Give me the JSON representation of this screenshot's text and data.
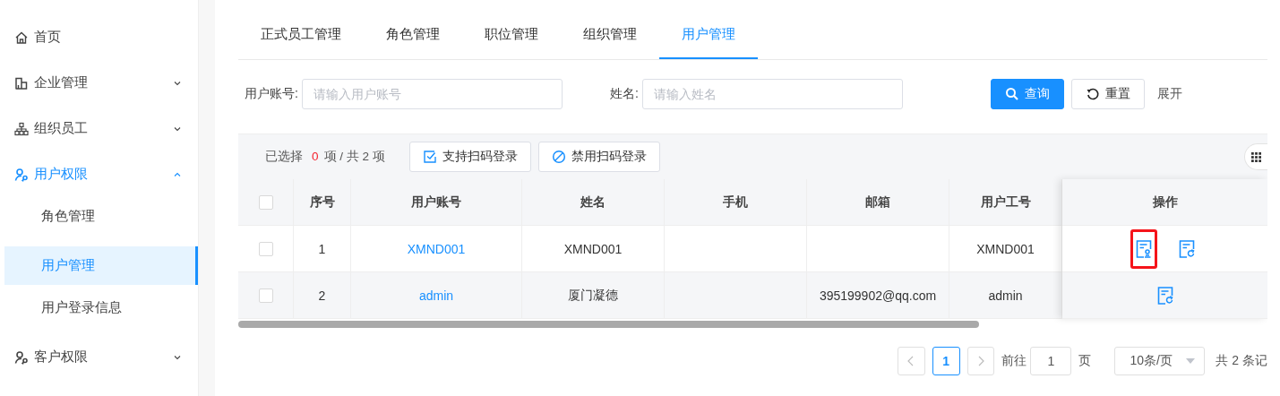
{
  "sidebar": {
    "items": [
      {
        "label": "首页",
        "has_caret": false,
        "selected": false
      },
      {
        "label": "企业管理",
        "expanded": false,
        "has_caret": true,
        "selected": false
      },
      {
        "label": "组织员工",
        "expanded": false,
        "has_caret": true,
        "selected": false
      },
      {
        "label": "用户权限",
        "expanded": true,
        "has_caret": true,
        "selected": true,
        "children": [
          {
            "label": "角色管理",
            "selected": false
          },
          {
            "label": "用户管理",
            "selected": true
          },
          {
            "label": "用户登录信息",
            "selected": false
          }
        ]
      },
      {
        "label": "客户权限",
        "expanded": false,
        "has_caret": true,
        "selected": false
      }
    ]
  },
  "tabs": [
    {
      "label": "正式员工管理",
      "selected": false
    },
    {
      "label": "角色管理",
      "selected": false
    },
    {
      "label": "职位管理",
      "selected": false
    },
    {
      "label": "组织管理",
      "selected": false
    },
    {
      "label": "用户管理",
      "selected": true
    }
  ],
  "search": {
    "fields": [
      {
        "label": "用户账号:",
        "placeholder": "请输入用户账号"
      },
      {
        "label": "姓名:",
        "placeholder": "请输入姓名"
      }
    ],
    "query_button": "查询",
    "reset_button": "重置",
    "expand_link": "展开"
  },
  "toolbar": {
    "selected_prefix": "已选择",
    "selected_count": "0",
    "selected_suffix": "项 / 共 2 项",
    "buttons": [
      {
        "label": "支持扫码登录",
        "kind": "enable"
      },
      {
        "label": "禁用扫码登录",
        "kind": "disable"
      }
    ]
  },
  "table": {
    "all_checked": false,
    "columns": [
      "序号",
      "用户账号",
      "姓名",
      "手机",
      "邮箱",
      "用户工号",
      "操作"
    ],
    "rows": [
      {
        "checked": false,
        "cells": [
          "1",
          "XMND001",
          "XMND001",
          "",
          "",
          "XMND001"
        ],
        "actions": [
          {
            "kind": "stamp",
            "highlighted": true
          },
          {
            "kind": "refresh",
            "highlighted": false
          }
        ]
      },
      {
        "checked": false,
        "cells": [
          "2",
          "admin",
          "厦门凝德",
          "",
          "395199902@qq.com",
          "admin"
        ],
        "actions": [
          {
            "kind": "refresh",
            "highlighted": false
          }
        ]
      }
    ]
  },
  "pagination": {
    "pages": [
      {
        "label": "1",
        "selected": true
      }
    ],
    "goto_label": "前往",
    "goto_value": "1",
    "page_unit": "页",
    "page_size": "10条/页",
    "total": "共 2 条记"
  }
}
